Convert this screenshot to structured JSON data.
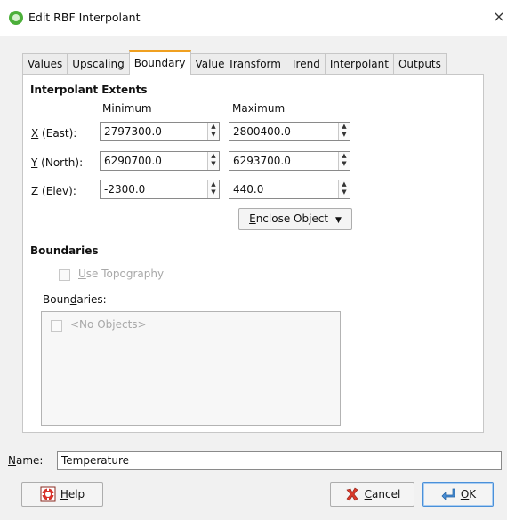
{
  "window": {
    "title": "Edit RBF Interpolant",
    "close_glyph": "×",
    "app_icon": "leapfrog-app-icon"
  },
  "tabs": [
    {
      "label": "Values",
      "active": false
    },
    {
      "label": "Upscaling",
      "active": false
    },
    {
      "label": "Boundary",
      "active": true
    },
    {
      "label": "Value Transform",
      "active": false
    },
    {
      "label": "Trend",
      "active": false
    },
    {
      "label": "Interpolant",
      "active": false
    },
    {
      "label": "Outputs",
      "active": false
    }
  ],
  "extents": {
    "title": "Interpolant Extents",
    "col_min": "Minimum",
    "col_max": "Maximum",
    "rows": [
      {
        "key": "X",
        "suffix": " (East):",
        "min": "2797300.0",
        "max": "2800400.0"
      },
      {
        "key": "Y",
        "suffix": " (North):",
        "min": "6290700.0",
        "max": "6293700.0"
      },
      {
        "key": "Z",
        "suffix": " (Elev):",
        "min": "-2300.0",
        "max": "440.0"
      }
    ],
    "enclose_key": "E",
    "enclose_rest": "nclose Object",
    "dropdown_glyph": "▼"
  },
  "boundaries": {
    "title": "Boundaries",
    "use_topo_key": "U",
    "use_topo_rest": "se Topography",
    "list_label_pre": "Boun",
    "list_label_key": "d",
    "list_label_post": "aries:",
    "empty_item": "<No Objects>"
  },
  "name": {
    "label_key": "N",
    "label_rest": "ame:",
    "value": "Temperature"
  },
  "buttons": {
    "help_key": "H",
    "help_rest": "elp",
    "cancel_key": "C",
    "cancel_rest": "ancel",
    "ok_key": "O",
    "ok_rest": "K"
  },
  "colors": {
    "active_tab_accent": "#f0a020",
    "default_button_border": "#4a90d9",
    "app_icon_green": "#4caf3a",
    "cancel_icon_red": "#d93a2b",
    "help_icon_red": "#d8322a"
  }
}
